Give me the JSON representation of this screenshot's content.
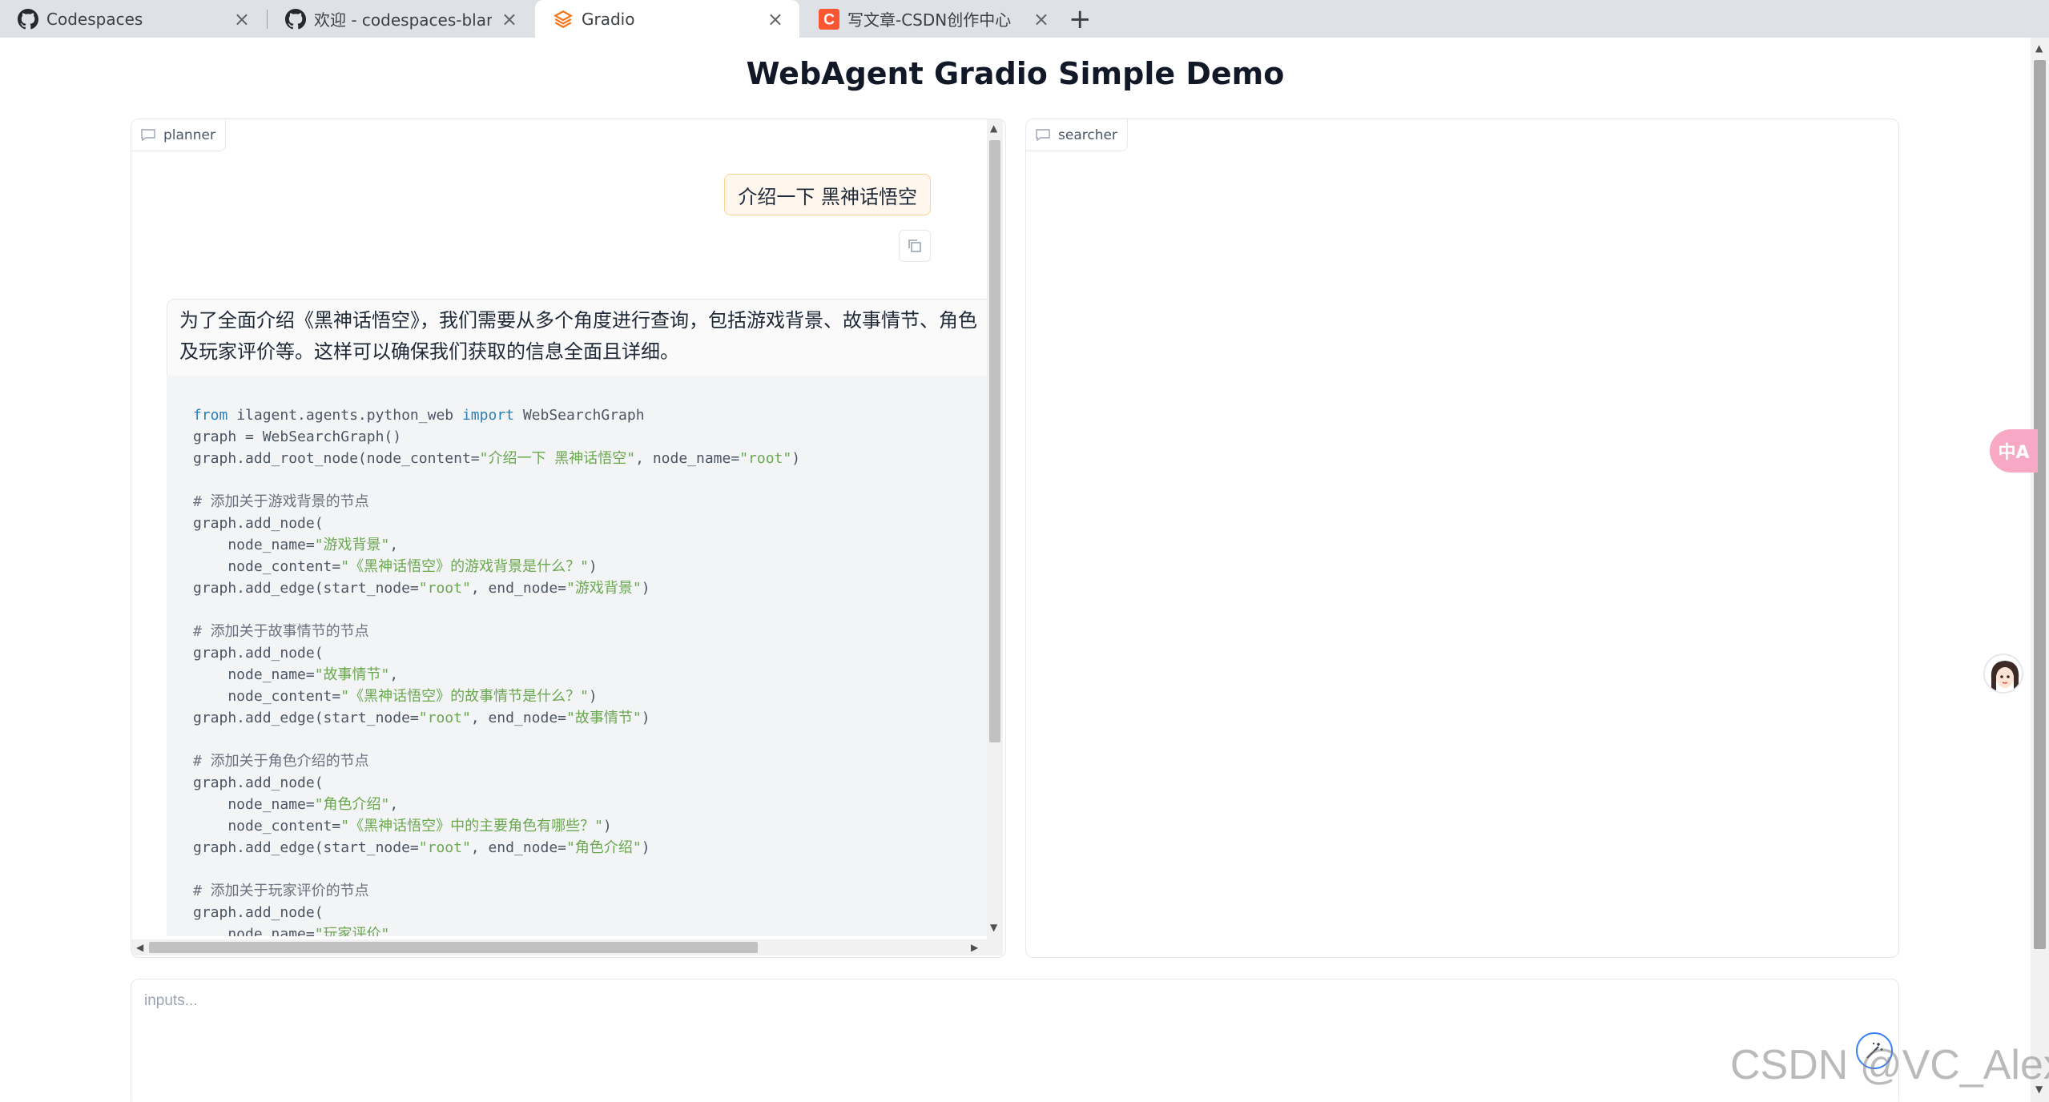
{
  "browser": {
    "tabs": [
      {
        "title": "Codespaces",
        "icon": "github-icon"
      },
      {
        "title": "欢迎 - codespaces-blank [",
        "icon": "github-icon"
      },
      {
        "title": "Gradio",
        "icon": "gradio-icon",
        "active": true
      },
      {
        "title": "写文章-CSDN创作中心",
        "icon": "csdn-icon"
      }
    ],
    "close_glyph": "×",
    "new_tab_glyph": "+"
  },
  "app": {
    "title": "WebAgent Gradio Simple Demo"
  },
  "planner": {
    "label": "planner",
    "user_message": "介绍一下 黑神话悟空",
    "bot_message_line1": "为了全面介绍《黑神话悟空》，我们需要从多个角度进行查询，包括游戏背景、故事情节、角色",
    "bot_message_line2": "及玩家评价等。这样可以确保我们获取的信息全面且详细。",
    "code": {
      "l1_kw1": "from",
      "l1_mod": " ilagent.agents.python_web ",
      "l1_kw2": "import",
      "l1_cls": " WebSearchGraph",
      "l2": "graph = WebSearchGraph()",
      "l3_a": "graph.add_root_node(node_content=",
      "l3_s1": "\"介绍一下 黑神话悟空\"",
      "l3_b": ", node_name=",
      "l3_s2": "\"root\"",
      "l3_c": ")",
      "c1": "# 添加关于游戏背景的节点",
      "n1_open": "graph.add_node(",
      "n1_name_a": "    node_name=",
      "n1_name_s": "\"游戏背景\"",
      "n1_name_b": ",",
      "n1_content_a": "    node_content=",
      "n1_content_s": "\"《黑神话悟空》的游戏背景是什么？\"",
      "n1_content_b": ")",
      "e1_a": "graph.add_edge(start_node=",
      "e1_s1": "\"root\"",
      "e1_b": ", end_node=",
      "e1_s2": "\"游戏背景\"",
      "e1_c": ")",
      "c2": "# 添加关于故事情节的节点",
      "n2_open": "graph.add_node(",
      "n2_name_a": "    node_name=",
      "n2_name_s": "\"故事情节\"",
      "n2_name_b": ",",
      "n2_content_a": "    node_content=",
      "n2_content_s": "\"《黑神话悟空》的故事情节是什么？\"",
      "n2_content_b": ")",
      "e2_a": "graph.add_edge(start_node=",
      "e2_s1": "\"root\"",
      "e2_b": ", end_node=",
      "e2_s2": "\"故事情节\"",
      "e2_c": ")",
      "c3": "# 添加关于角色介绍的节点",
      "n3_open": "graph.add_node(",
      "n3_name_a": "    node_name=",
      "n3_name_s": "\"角色介绍\"",
      "n3_name_b": ",",
      "n3_content_a": "    node_content=",
      "n3_content_s": "\"《黑神话悟空》中的主要角色有哪些？\"",
      "n3_content_b": ")",
      "e3_a": "graph.add_edge(start_node=",
      "e3_s1": "\"root\"",
      "e3_b": ", end_node=",
      "e3_s2": "\"角色介绍\"",
      "e3_c": ")",
      "c4": "# 添加关于玩家评价的节点",
      "n4_open": "graph.add_node(",
      "n4_name_a": "    node_name=",
      "n4_name_s": "\"玩家评价\"",
      "n4_name_b": ","
    }
  },
  "searcher": {
    "label": "searcher"
  },
  "input": {
    "placeholder": "inputs..."
  },
  "widgets": {
    "translate_label": "中A"
  },
  "watermark": "CSDN @VC_Alexa",
  "colors": {
    "user_bubble_bg": "#fff7ed",
    "code_bg": "#f3f4f6",
    "code_keyword": "#2a7fb8",
    "code_string": "#6aa84f",
    "accent": "#3b82f6"
  }
}
